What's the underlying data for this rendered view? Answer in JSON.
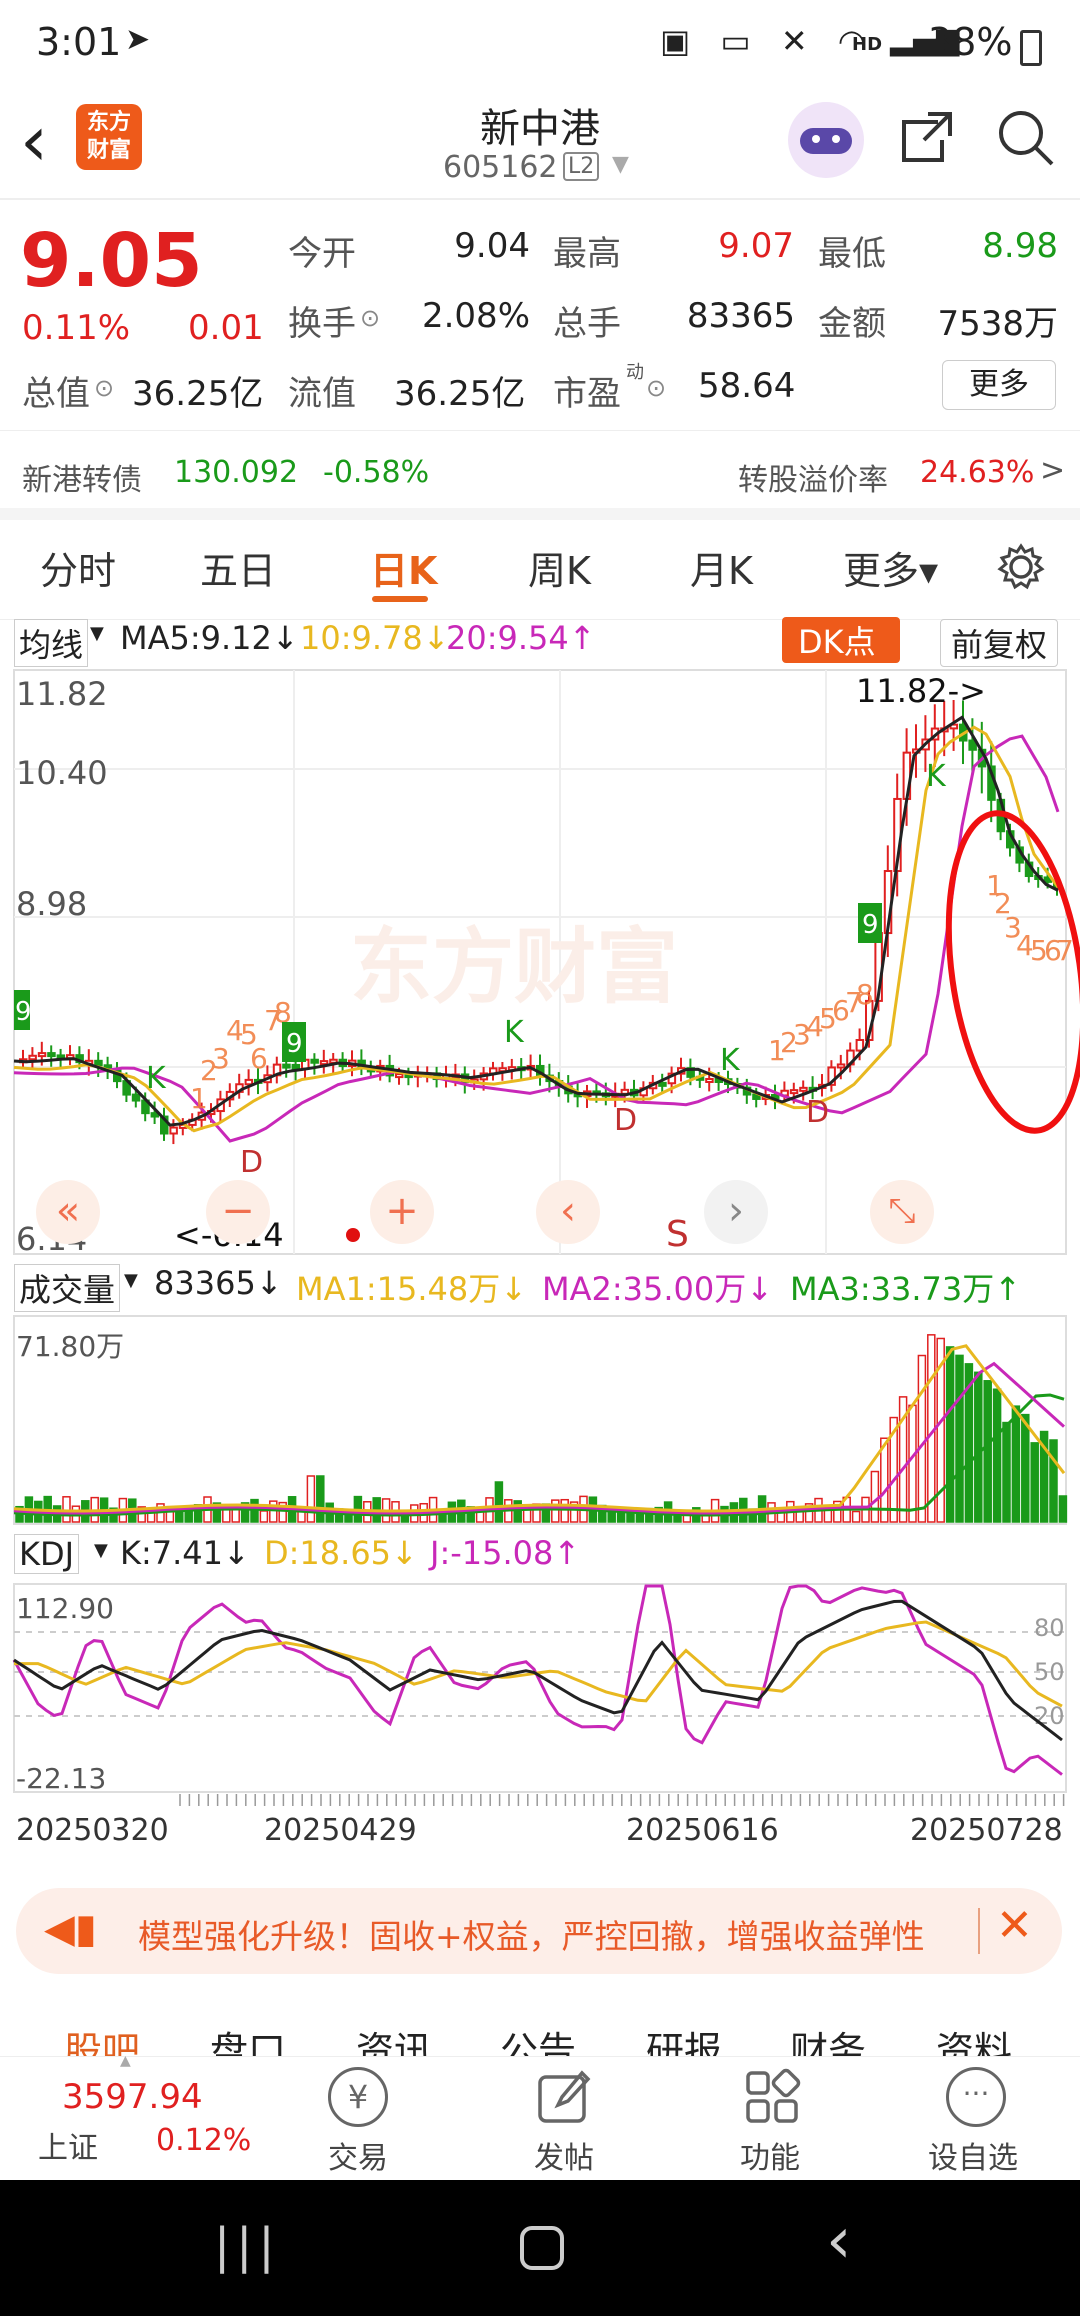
{
  "status": {
    "time": "3:01",
    "battery": "38%",
    "network": "HD"
  },
  "header": {
    "back": "‹",
    "logo_top": "东方",
    "logo_bottom": "财富",
    "stock_name": "新中港",
    "stock_code": "605162",
    "level_badge": "L2"
  },
  "quote": {
    "price": "9.05",
    "change_pct": "0.11%",
    "change": "0.01",
    "open_label": "今开",
    "open": "9.04",
    "high_label": "最高",
    "high": "9.07",
    "low_label": "最低",
    "low": "8.98",
    "turnover_label": "换手",
    "turnover": "2.08%",
    "volume_label": "总手",
    "volume": "83365",
    "amount_label": "金额",
    "amount": "7538万",
    "mktcap_label": "总值",
    "mktcap": "36.25亿",
    "float_label": "流值",
    "float_cap": "36.25亿",
    "pe_label": "市盈",
    "pe_sup": "动",
    "pe": "58.64",
    "more": "更多"
  },
  "convertible": {
    "name": "新港转债",
    "price": "130.092",
    "change": "-0.58%",
    "premium_label": "转股溢价率",
    "premium": "24.63%",
    "arrow": ">"
  },
  "tabs": [
    {
      "label": "分时"
    },
    {
      "label": "五日"
    },
    {
      "label": "日K"
    },
    {
      "label": "周K"
    },
    {
      "label": "月K"
    },
    {
      "label": "更多▾"
    }
  ],
  "ma": {
    "selector": "均线",
    "ma5": "MA5:9.12↓",
    "ma10": "10:9.78↓",
    "ma20": "20:9.54↑",
    "dk": "DK点",
    "fq": "前复权"
  },
  "kchart": {
    "y_top": "11.82",
    "y_mid1": "10.40",
    "y_mid2": "8.98",
    "y_bot": "6.14",
    "high_marker": "11.82->",
    "low_marker": "<-6.14",
    "watermark": "东方财富",
    "s_label": "S"
  },
  "volume": {
    "selector": "成交量",
    "value": "83365↓",
    "ma1": "MA1:15.48万↓",
    "ma2": "MA2:35.00万↓",
    "ma3": "MA3:33.73万↑",
    "max": "71.80万"
  },
  "kdj": {
    "selector": "KDJ",
    "k": "K:7.41↓",
    "d": "D:18.65↓",
    "j": "J:-15.08↑",
    "top": "112.90",
    "bottom": "-22.13",
    "l80": "80",
    "l50": "50",
    "l20": "20"
  },
  "dates": [
    "20250320",
    "20250429",
    "20250616",
    "20250728"
  ],
  "banner": {
    "text": "模型强化升级！固收+权益，严控回撤，增强收益弹性"
  },
  "bottom_tabs": [
    "股吧",
    "盘口",
    "资讯",
    "公告",
    "研报",
    "财务",
    "资料"
  ],
  "bottom_bar": {
    "index_value": "3597.94",
    "index_name": "上证",
    "index_change": "0.12%",
    "trade": "交易",
    "post": "发帖",
    "functions": "功能",
    "watchlist": "设自选"
  },
  "colors": {
    "up": "#e02020",
    "down": "#1a9a1a",
    "accent": "#e8631a",
    "ma5": "#222222",
    "ma10": "#e8b820",
    "ma20": "#c828b8"
  }
}
